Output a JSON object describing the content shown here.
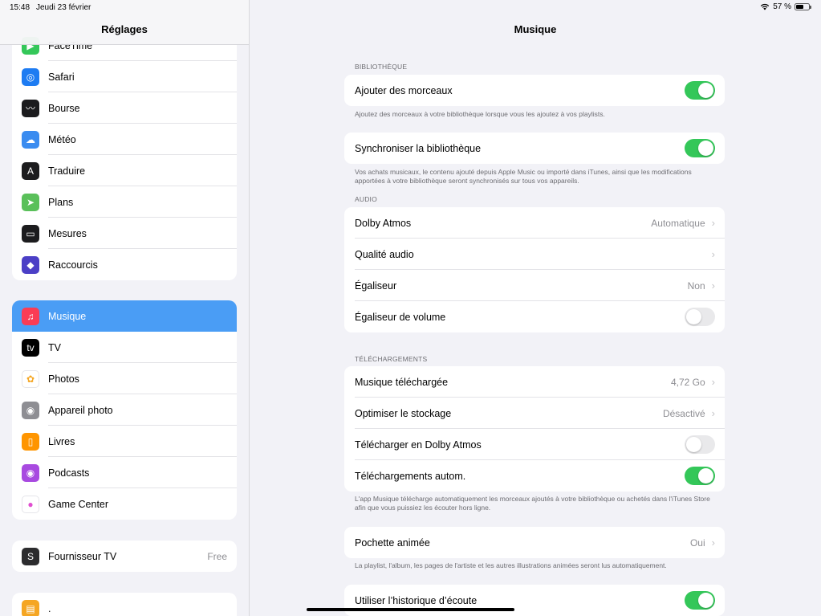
{
  "status_bar": {
    "time": "15:48",
    "date": "Jeudi 23 février",
    "battery": "57 %",
    "battery_level": 0.57
  },
  "sidebar": {
    "title": "Réglages",
    "group1": [
      {
        "label": "FaceTime",
        "icon": "facetime-icon",
        "color": "#34c759"
      },
      {
        "label": "Safari",
        "icon": "safari-icon",
        "color": "#1e7cf2"
      },
      {
        "label": "Bourse",
        "icon": "stocks-icon",
        "color": "#1c1c1e"
      },
      {
        "label": "Météo",
        "icon": "weather-icon",
        "color": "#3a8cf0"
      },
      {
        "label": "Traduire",
        "icon": "translate-icon",
        "color": "#1c1c1e"
      },
      {
        "label": "Plans",
        "icon": "maps-icon",
        "color": "#5ac05a"
      },
      {
        "label": "Mesures",
        "icon": "measure-icon",
        "color": "#1c1c1e"
      },
      {
        "label": "Raccourcis",
        "icon": "shortcuts-icon",
        "color": "#4b3fc6"
      }
    ],
    "group2": [
      {
        "label": "Musique",
        "icon": "music-icon",
        "color": "#fa3c55",
        "selected": true
      },
      {
        "label": "TV",
        "icon": "tv-icon",
        "color": "#000000"
      },
      {
        "label": "Photos",
        "icon": "photos-icon",
        "color": "#ffffff"
      },
      {
        "label": "Appareil photo",
        "icon": "camera-icon",
        "color": "#8e8e93"
      },
      {
        "label": "Livres",
        "icon": "books-icon",
        "color": "#ff9500"
      },
      {
        "label": "Podcasts",
        "icon": "podcasts-icon",
        "color": "#a84ae0"
      },
      {
        "label": "Game Center",
        "icon": "game-center-icon",
        "color": "#ffffff"
      }
    ],
    "group3": [
      {
        "label": "Fournisseur TV",
        "value": "Free",
        "icon": "tv-provider-icon",
        "color": "#2c2c2e"
      }
    ],
    "group4": [
      {
        "label": ".",
        "icon": "app-icon",
        "color": "#f5a623"
      }
    ]
  },
  "main": {
    "title": "Musique",
    "sections": {
      "library_header": "BIBLIOTHÈQUE",
      "add_tracks": "Ajouter des morceaux",
      "add_tracks_on": true,
      "add_tracks_footer": "Ajoutez des morceaux à votre bibliothèque lorsque vous les ajoutez à vos playlists.",
      "sync_library": "Synchroniser la bibliothèque",
      "sync_library_on": true,
      "sync_footer": "Vos achats musicaux, le contenu ajouté depuis Apple Music ou importé dans iTunes, ainsi que les modifications apportées à votre bibliothèque seront synchronisés sur tous vos appareils.",
      "audio_header": "AUDIO",
      "dolby_atmos": "Dolby Atmos",
      "dolby_atmos_value": "Automatique",
      "audio_quality": "Qualité audio",
      "equalizer": "Égaliseur",
      "equalizer_value": "Non",
      "volume_eq": "Égaliseur de volume",
      "volume_eq_on": false,
      "downloads_header": "TÉLÉCHARGEMENTS",
      "downloaded_music": "Musique téléchargée",
      "downloaded_music_value": "4,72 Go",
      "optimize_storage": "Optimiser le stockage",
      "optimize_storage_value": "Désactivé",
      "download_dolby": "Télécharger en Dolby Atmos",
      "download_dolby_on": false,
      "auto_downloads": "Téléchargements autom.",
      "auto_downloads_on": true,
      "downloads_footer": "L'app Musique télécharge automatiquement les morceaux ajoutés à votre bibliothèque ou achetés dans l'iTunes Store afin que vous puissiez les écouter hors ligne.",
      "animated_art": "Pochette animée",
      "animated_art_value": "Oui",
      "animated_art_footer": "La playlist, l'album, les pages de l'artiste et les autres illustrations animées seront lus automatiquement.",
      "listening_history": "Utiliser l’historique d’écoute",
      "listening_history_on": true
    }
  }
}
